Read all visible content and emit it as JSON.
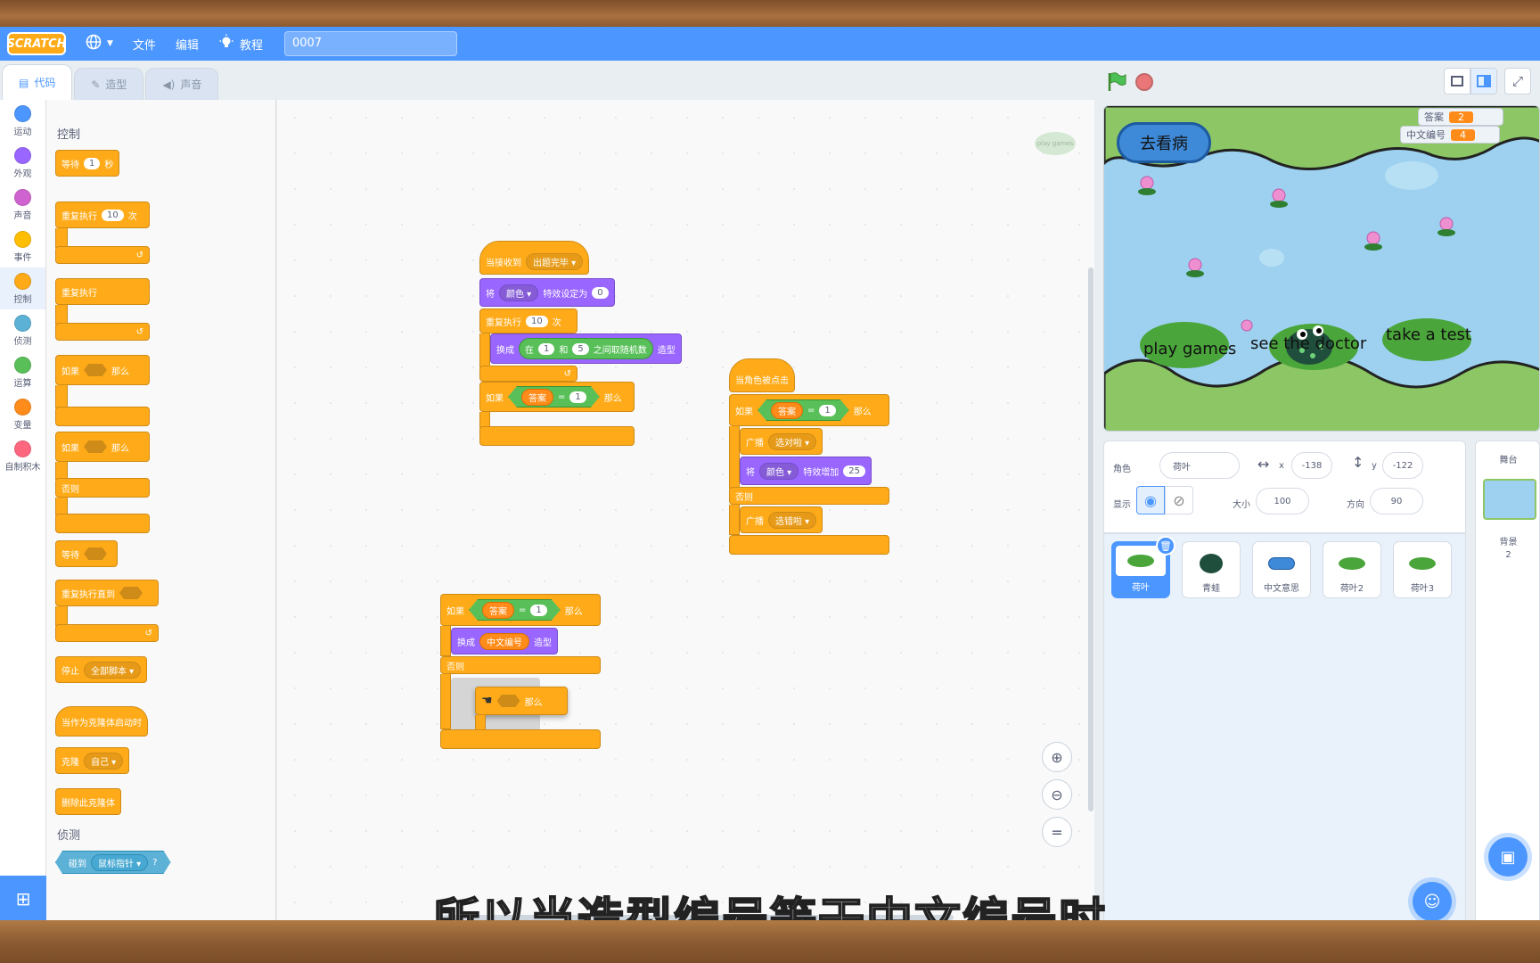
{
  "menubar": {
    "logo": "SCRATCH",
    "file": "文件",
    "edit": "编辑",
    "tutorials": "教程",
    "project_title": "0007"
  },
  "tabs": {
    "code": "代码",
    "costumes": "造型",
    "sounds": "声音"
  },
  "categories": [
    {
      "label": "运动",
      "color": "#4c97ff"
    },
    {
      "label": "外观",
      "color": "#9966ff"
    },
    {
      "label": "声音",
      "color": "#cf63cf"
    },
    {
      "label": "事件",
      "color": "#ffbf00"
    },
    {
      "label": "控制",
      "color": "#ffab19"
    },
    {
      "label": "侦测",
      "color": "#5cb1d6"
    },
    {
      "label": "运算",
      "color": "#59c059"
    },
    {
      "label": "变量",
      "color": "#ff8c1a"
    },
    {
      "label": "自制积木",
      "color": "#ff6680"
    }
  ],
  "palette": {
    "section_control": "控制",
    "wait": "等待",
    "wait_val": "1",
    "wait_unit": "秒",
    "repeat": "重复执行",
    "repeat_val": "10",
    "repeat_unit": "次",
    "forever": "重复执行",
    "if": "如果",
    "then": "那么",
    "else": "否则",
    "wait_until": "等待",
    "repeat_until": "重复执行直到",
    "stop": "停止",
    "stop_opt": "全部脚本",
    "clone_start": "当作为克隆体启动时",
    "clone": "克隆",
    "clone_opt": "自己",
    "delete_clone": "删除此克隆体",
    "section_sensing": "侦测",
    "touching": "碰到",
    "touching_opt": "鼠标指针",
    "q": "?"
  },
  "scripts": {
    "s1": {
      "hat": "当接收到",
      "msg": "出题完毕",
      "set": "将",
      "effect": "颜色",
      "set_to": "特效设定为",
      "set_val": "0",
      "repeat": "重复执行",
      "repeat_val": "10",
      "times": "次",
      "switch": "换成",
      "in": "在",
      "a": "1",
      "and": "和",
      "b": "5",
      "rand": "之间取随机数",
      "costume": "造型",
      "if": "如果",
      "ans": "答案",
      "eq": "=",
      "one": "1",
      "then": "那么"
    },
    "s2": {
      "hat": "当角色被点击",
      "if": "如果",
      "ans": "答案",
      "eq": "=",
      "one": "1",
      "then": "那么",
      "bc": "广播",
      "msg1": "选对啦",
      "change": "将",
      "effect": "颜色",
      "change_by": "特效增加",
      "val": "25",
      "else": "否则",
      "bc2": "广播",
      "msg2": "选错啦"
    },
    "s3": {
      "if": "如果",
      "ans": "答案",
      "eq": "=",
      "one": "1",
      "then": "那么",
      "switch": "换成",
      "var": "中文编号",
      "costume": "造型",
      "else": "否则",
      "drag_if": "如果",
      "drag_then": "那么"
    }
  },
  "stage": {
    "monitor1_label": "答案",
    "monitor1_val": "2",
    "monitor2_label": "中文编号",
    "monitor2_val": "4",
    "btn": "去看病",
    "pad1": "play games",
    "pad2": "see the doctor",
    "pad3": "take a test",
    "ws_pad": "play games"
  },
  "sprite_info": {
    "sprite_lbl": "角色",
    "sprite_name": "荷叶",
    "x_lbl": "x",
    "x": "-138",
    "y_lbl": "y",
    "y": "-122",
    "show_lbl": "显示",
    "size_lbl": "大小",
    "size": "100",
    "dir_lbl": "方向",
    "dir": "90"
  },
  "sprites": [
    {
      "name": "荷叶"
    },
    {
      "name": "青蛙"
    },
    {
      "name": "中文意思"
    },
    {
      "name": "荷叶2"
    },
    {
      "name": "荷叶3"
    }
  ],
  "stage_pane": {
    "title": "舞台",
    "bg": "背景",
    "bg_count": "2"
  },
  "subtitle": "所以当造型编号等于中文编号时"
}
